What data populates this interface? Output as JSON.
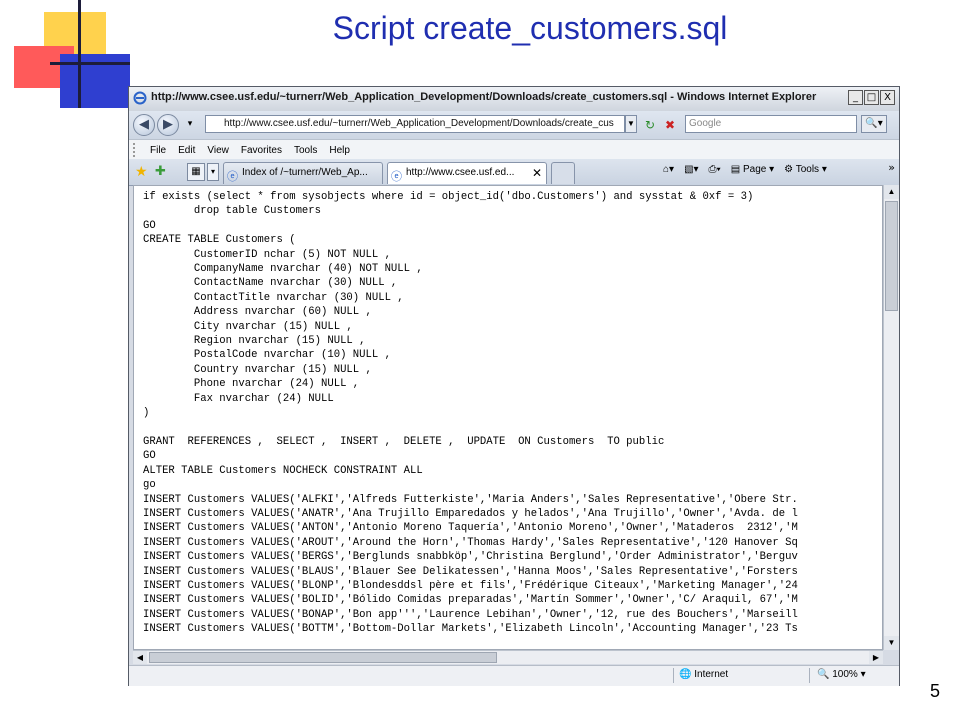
{
  "slide": {
    "title": "Script create_customers.sql",
    "number": "5"
  },
  "window": {
    "title": "http://www.csee.usf.edu/~turnerr/Web_Application_Development/Downloads/create_customers.sql - Windows Internet Explorer",
    "controls": [
      "_",
      "□",
      "X"
    ]
  },
  "address": {
    "url": "http://www.csee.usf.edu/~turnerr/Web_Application_Development/Downloads/create_cus",
    "search_placeholder": "Google"
  },
  "menu": [
    "File",
    "Edit",
    "View",
    "Favorites",
    "Tools",
    "Help"
  ],
  "tabs": [
    {
      "label": "Index of /~turnerr/Web_Ap..."
    },
    {
      "label": "http://www.csee.usf.ed..."
    }
  ],
  "commands": {
    "page": "Page",
    "tools": "Tools"
  },
  "code_lines": [
    "if exists (select * from sysobjects where id = object_id('dbo.Customers') and sysstat & 0xf = 3)",
    "        drop table Customers",
    "GO",
    "CREATE TABLE Customers (",
    "        CustomerID nchar (5) NOT NULL ,",
    "        CompanyName nvarchar (40) NOT NULL ,",
    "        ContactName nvarchar (30) NULL ,",
    "        ContactTitle nvarchar (30) NULL ,",
    "        Address nvarchar (60) NULL ,",
    "        City nvarchar (15) NULL ,",
    "        Region nvarchar (15) NULL ,",
    "        PostalCode nvarchar (10) NULL ,",
    "        Country nvarchar (15) NULL ,",
    "        Phone nvarchar (24) NULL ,",
    "        Fax nvarchar (24) NULL",
    ")",
    "",
    "GRANT  REFERENCES ,  SELECT ,  INSERT ,  DELETE ,  UPDATE  ON Customers  TO public",
    "GO",
    "ALTER TABLE Customers NOCHECK CONSTRAINT ALL",
    "go",
    "INSERT Customers VALUES('ALFKI','Alfreds Futterkiste','Maria Anders','Sales Representative','Obere Str.",
    "INSERT Customers VALUES('ANATR','Ana Trujillo Emparedados y helados','Ana Trujillo','Owner','Avda. de l",
    "INSERT Customers VALUES('ANTON','Antonio Moreno Taquería','Antonio Moreno','Owner','Mataderos  2312','M",
    "INSERT Customers VALUES('AROUT','Around the Horn','Thomas Hardy','Sales Representative','120 Hanover Sq",
    "INSERT Customers VALUES('BERGS','Berglunds snabbköp','Christina Berglund','Order Administrator','Berguv",
    "INSERT Customers VALUES('BLAUS','Blauer See Delikatessen','Hanna Moos','Sales Representative','Forsters",
    "INSERT Customers VALUES('BLONP','Blondesddsl père et fils','Frédérique Citeaux','Marketing Manager','24",
    "INSERT Customers VALUES('BOLID','Bólido Comidas preparadas','Martín Sommer','Owner','C/ Araquil, 67','M",
    "INSERT Customers VALUES('BONAP','Bon app''','Laurence Lebihan','Owner','12, rue des Bouchers','Marseill",
    "INSERT Customers VALUES('BOTTM','Bottom-Dollar Markets','Elizabeth Lincoln','Accounting Manager','23 Ts"
  ],
  "status": {
    "zone": "Internet",
    "zoom": "100%"
  },
  "colors": {
    "title": "#1f2eb0",
    "deco_yellow": "#ffd24d",
    "deco_red": "#ff5a5a",
    "deco_blue": "#2f3fd0"
  }
}
